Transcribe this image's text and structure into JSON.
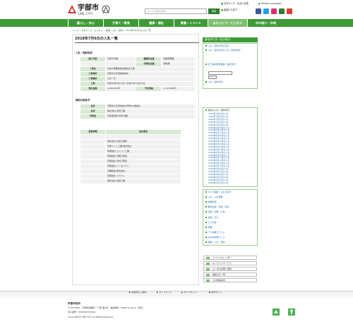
{
  "header": {
    "logo_jp": "宇部市",
    "logo_en": "UBE CITY",
    "search_placeholder": "Google 提供の検索",
    "search_button": "検索",
    "links": [
      "文字サイズ・色合い変更",
      "Foreign Language",
      "組織から探す"
    ],
    "sns_colors": [
      "#3b5998",
      "#1da1f2",
      "#e1306c",
      "#2e7d32",
      "#e53935"
    ]
  },
  "nav": [
    "暮らし・安心",
    "子育て・教育",
    "健康・福祉",
    "教養・イベント",
    "まちづくり・ビジネス",
    "市の紹介・市政"
  ],
  "breadcrumb": "トップ > まちづくり・ビジネス > 事業・入札・契約 > 2018年7月6日の入札一覧",
  "page_title": "2018年7月6日の入札一覧",
  "section1": "入札・契約状況",
  "table1": [
    [
      "施工年度",
      "平成30年度",
      "建築担当課",
      "道路整備課"
    ],
    [
      "",
      "",
      "予算担当課",
      "契約課"
    ],
    [
      "工事名",
      "市道大事業地線道路改良工事",
      "",
      ""
    ],
    [
      "工事場所",
      "宇部市大字東岐波地内",
      "",
      ""
    ],
    [
      "工事種別",
      "土木一式",
      "",
      ""
    ],
    [
      "工期",
      "平成30年7月11日～平成30年10月19日",
      "",
      ""
    ],
    [
      "落札金額",
      "2,999,000円",
      "予定価格",
      "1,712,880円"
    ]
  ],
  "section2": "契約の相手方",
  "table2": [
    [
      "住所",
      "宇部市大字東岐波大草町828番地4"
    ],
    [
      "名称",
      "株式会社 成田工業"
    ],
    [
      "代表者",
      "代表取締役 成田 道雄"
    ]
  ],
  "table3_headers": [
    "業者情報",
    "指名業者"
  ],
  "bidders": [
    "株式会社 内田工業所",
    "宇部トイレ工業 株式会社",
    "有限会社 エイシン工業",
    "有限会社 河野工務店",
    "有限会社 沢村工務店",
    "有限会社 シンセリティ",
    "高橋建設 株式会社",
    "有限会社 トラスト",
    "株式会社 成田工業"
  ],
  "sidebar": {
    "head": "まちづくり・ビジネス",
    "box1": [
      "入札・契約状況の目次",
      "入札・契約状況の公表（最新情報）"
    ],
    "box1b": [
      "市工事成果報告書（最新月分）"
    ],
    "box1c": [
      "入札・契約状況"
    ],
    "box2_title": "過去の入札・契約状況",
    "dates": [
      "2018年7月6日の入札",
      "2018年7月5日の入札",
      "2018年7月4日の入札",
      "2018年7月3日の入札",
      "2018年7月2日の入札",
      "2018年6月29日の入札",
      "2018年6月28日の入札",
      "2018年6月27日の入札",
      "2018年6月26日の入札",
      "2018年6月25日の入札",
      "2018年6月22日の入札",
      "2018年6月21日の入札",
      "2018年6月20日の入札",
      "2018年6月19日の入札",
      "2018年6月18日の入札",
      "2018年6月15日の入札",
      "2018年6月14日の入札",
      "2018年6月13日の入札",
      "2018年6月12日の入札",
      "2018年6月11日の入札",
      "2018年6月8日の入札",
      "2018年6月7日の入札",
      "2018年6月6日の入札",
      "2018年6月5日の入札",
      "2018年6月4日の入札",
      "2018年6月1日の入札"
    ],
    "links": [
      "すべて事業・入札を表示",
      "入札・入札結果",
      "開発情報",
      "都市計画・景観・緑化",
      "建築・開発・土地",
      "道路・河川",
      "上下水道",
      "農業",
      "うべ産業ブランド",
      "中山間地域づくり",
      "事業・入札・契約"
    ],
    "banners": [
      "イベントカレンダー",
      "オンラインサービス",
      "よくある質問と回答",
      "相談窓口一覧",
      "公共施設案内"
    ]
  },
  "footer": {
    "links": [
      "市役所のご案内",
      "サイトマップ",
      "サイトポリシー",
      "携帯サイト"
    ],
    "name": "宇部市役所",
    "address": "〒755-8601　宇部市常盤町一丁目7番1号　電話番号：0836-31-0111（代表）",
    "corp": "法人番号：3000020352021",
    "copyright": "Copyright(C) UBE CITY. All Rights Reserved."
  }
}
